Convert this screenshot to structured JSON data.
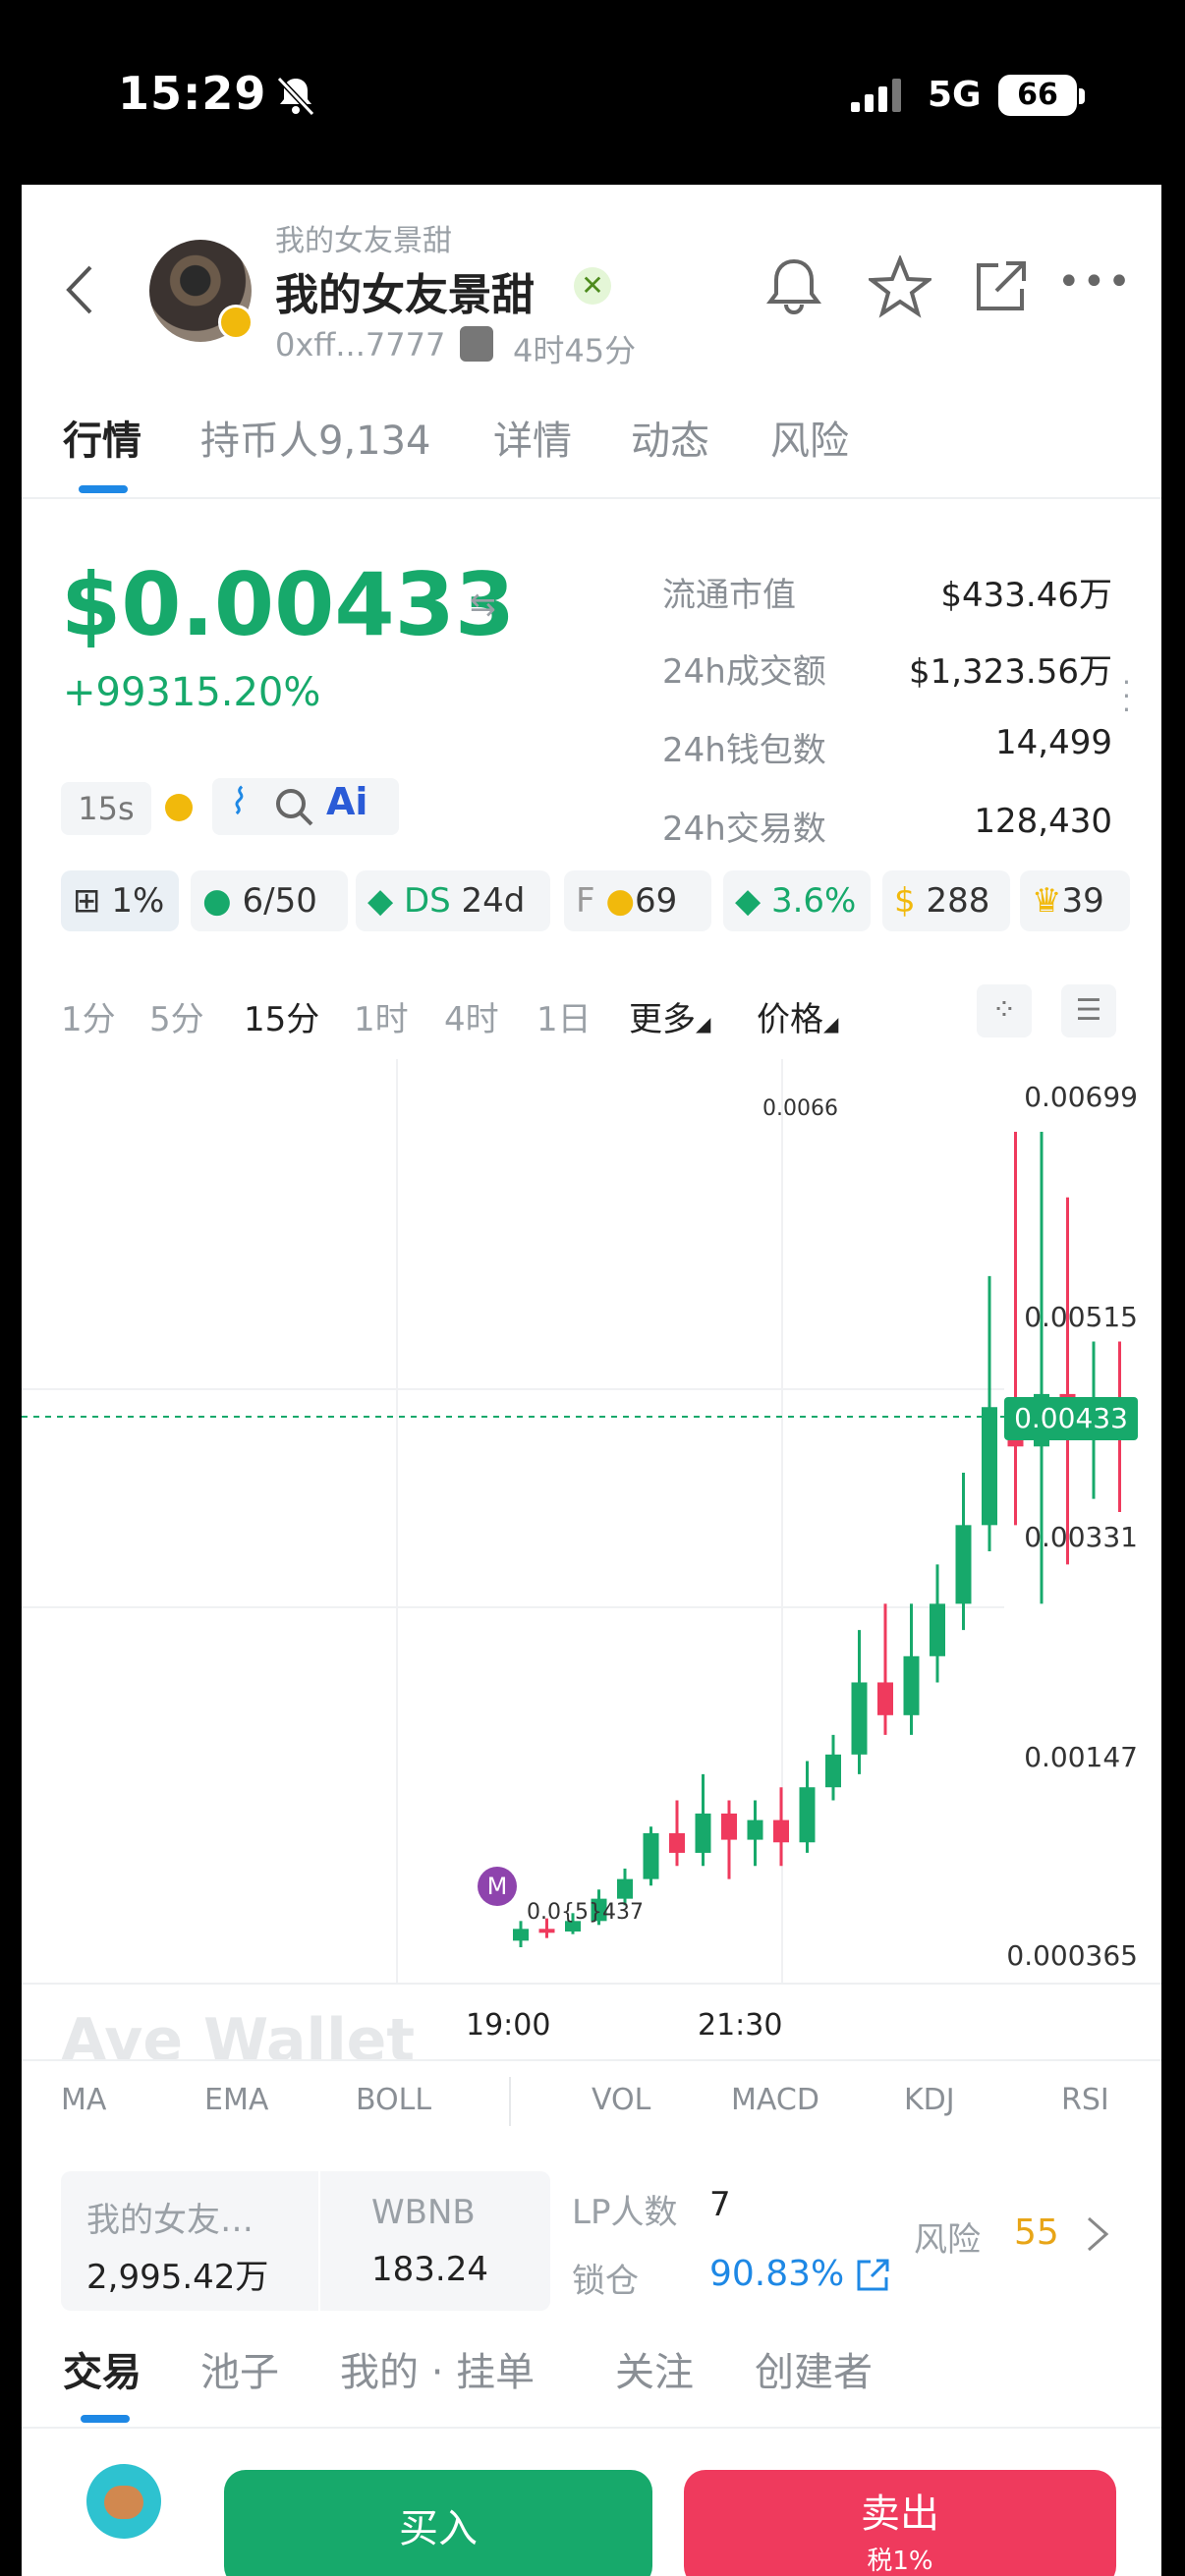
{
  "status_bar": {
    "time": "15:29",
    "network": "5G",
    "battery": "66"
  },
  "header": {
    "small_name": "我的女友景甜",
    "title": "我的女友景甜",
    "address": "0xff...7777",
    "age": "4时45分"
  },
  "tabs": [
    {
      "label": "行情"
    },
    {
      "label": "持币人9,134"
    },
    {
      "label": "详情"
    },
    {
      "label": "动态"
    },
    {
      "label": "风险"
    }
  ],
  "price": {
    "value": "$0.00433",
    "change": "+99315.20%"
  },
  "stats": [
    {
      "label": "流通市值",
      "value": "$433.46万"
    },
    {
      "label": "24h成交额",
      "value": "$1,323.56万"
    },
    {
      "label": "24h钱包数",
      "value": "14,499"
    },
    {
      "label": "24h交易数",
      "value": "128,430"
    }
  ],
  "tools": {
    "interval": "15s",
    "ai": "Ai"
  },
  "chips": {
    "gift": "1%",
    "holders": "6/50",
    "ds": "DS",
    "ds_days": "24d",
    "f": "F",
    "f_val": "69",
    "stack": "3.6%",
    "bag": "288",
    "trophy": "39"
  },
  "timeframes": [
    "1分",
    "5分",
    "15分",
    "1时",
    "4时",
    "1日",
    "更多",
    "价格"
  ],
  "chart_data": {
    "type": "candlestick",
    "y_ticks": [
      "0.00699",
      "0.00515",
      "0.00433",
      "0.00331",
      "0.00147",
      "0.000365"
    ],
    "x_ticks": [
      "19:00",
      "21:30"
    ],
    "current_price": "0.00433",
    "high_label": "0.0066",
    "low_label": "0.0{5}437",
    "watermark": "Ave Wallet",
    "marker": "M",
    "candles": [
      [
        0.00043,
        0.00052,
        0.00038,
        0.00058
      ],
      [
        0.00052,
        0.0005,
        0.00045,
        0.0006
      ],
      [
        0.0005,
        0.00058,
        0.00048,
        0.00064
      ],
      [
        0.00058,
        0.00075,
        0.00055,
        0.00082
      ],
      [
        0.00075,
        0.0009,
        0.0007,
        0.00098
      ],
      [
        0.0009,
        0.00125,
        0.00085,
        0.0013
      ],
      [
        0.00125,
        0.0011,
        0.001,
        0.0015
      ],
      [
        0.0011,
        0.0014,
        0.001,
        0.0017
      ],
      [
        0.0014,
        0.0012,
        0.0009,
        0.0015
      ],
      [
        0.0012,
        0.00135,
        0.001,
        0.0015
      ],
      [
        0.00135,
        0.00118,
        0.001,
        0.0016
      ],
      [
        0.00118,
        0.0016,
        0.0011,
        0.0018
      ],
      [
        0.0016,
        0.00185,
        0.0015,
        0.002
      ],
      [
        0.00185,
        0.0024,
        0.0017,
        0.0028
      ],
      [
        0.0024,
        0.00215,
        0.002,
        0.003
      ],
      [
        0.00215,
        0.0026,
        0.002,
        0.003
      ],
      [
        0.0026,
        0.003,
        0.0024,
        0.0033
      ],
      [
        0.003,
        0.0036,
        0.0028,
        0.004
      ],
      [
        0.0036,
        0.0045,
        0.0034,
        0.0055
      ],
      [
        0.0045,
        0.0042,
        0.0036,
        0.0066
      ],
      [
        0.0042,
        0.0046,
        0.003,
        0.0066
      ],
      [
        0.0046,
        0.0043,
        0.0033,
        0.0061
      ],
      [
        0.0043,
        0.0044,
        0.0038,
        0.005
      ],
      [
        0.0044,
        0.00433,
        0.0037,
        0.005
      ]
    ]
  },
  "indicators": [
    "MA",
    "EMA",
    "BOLL",
    "VOL",
    "MACD",
    "KDJ",
    "RSI"
  ],
  "pool": {
    "token_name": "我的女友…",
    "token_amount": "2,995.42万",
    "base_name": "WBNB",
    "base_amount": "183.24",
    "lp_label": "LP人数",
    "lp_count": "7",
    "lock_label": "锁仓",
    "lock_pct": "90.83%",
    "risk_label": "风险",
    "risk_score": "55"
  },
  "bottom_tabs": [
    "交易",
    "池子",
    "我的 · 挂单",
    "关注",
    "创建者"
  ],
  "actions": {
    "buy": "买入",
    "sell": "卖出",
    "tax": "税1%"
  },
  "colors": {
    "green": "#17a96b",
    "red": "#ef3a5d",
    "accent": "#1e88e5"
  }
}
